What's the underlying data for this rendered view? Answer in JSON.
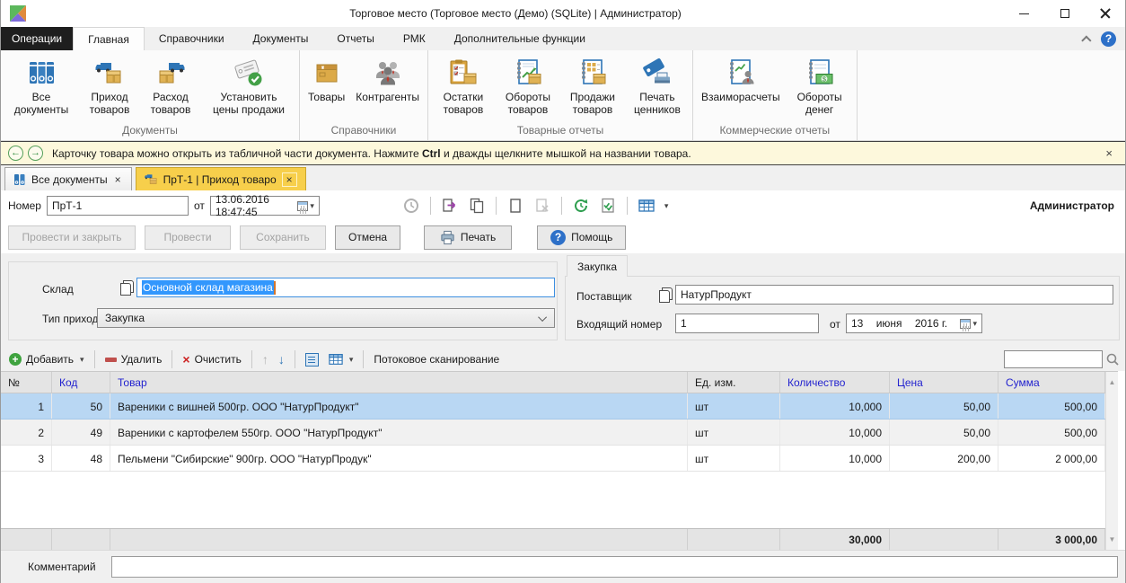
{
  "window": {
    "title": "Торговое место (Торговое место (Демо) (SQLite) | Администратор)"
  },
  "glyphs": {
    "back": "←",
    "forward": "→",
    "close": "×",
    "dropdown": "▾",
    "up": "↑",
    "down": "↓",
    "scroll_up": "▲",
    "scroll_down": "▼",
    "help": "?",
    "plus": "+",
    "clear_x": "×"
  },
  "menubar": {
    "app_button": "Операции",
    "tabs": [
      "Главная",
      "Справочники",
      "Документы",
      "Отчеты",
      "РМК",
      "Дополнительные функции"
    ],
    "active_tab": "Главная"
  },
  "ribbon": {
    "groups": [
      {
        "title": "Документы",
        "buttons": [
          {
            "label": "Все документы",
            "icon": "binders-icon"
          },
          {
            "label": "Приход товаров",
            "icon": "goods-receipt-icon"
          },
          {
            "label": "Расход товаров",
            "icon": "goods-issue-icon"
          },
          {
            "label": "Установить цены продажи",
            "icon": "price-tag-check-icon"
          }
        ]
      },
      {
        "title": "Справочники",
        "buttons": [
          {
            "label": "Товары",
            "icon": "goods-box-icon"
          },
          {
            "label": "Контрагенты",
            "icon": "counterparties-icon"
          }
        ]
      },
      {
        "title": "Товарные отчеты",
        "buttons": [
          {
            "label": "Остатки товаров",
            "icon": "stock-report-icon"
          },
          {
            "label": "Обороты товаров",
            "icon": "goods-turnover-icon"
          },
          {
            "label": "Продажи товаров",
            "icon": "goods-sales-icon"
          },
          {
            "label": "Печать ценников",
            "icon": "print-price-tags-icon"
          }
        ]
      },
      {
        "title": "Коммерческие отчеты",
        "buttons": [
          {
            "label": "Взаиморасчеты",
            "icon": "settlements-icon"
          },
          {
            "label": "Обороты денег",
            "icon": "money-turnover-icon"
          }
        ]
      }
    ]
  },
  "notification": {
    "text_before": "Карточку товара можно открыть из табличной части документа. Нажмите ",
    "bold": "Ctrl",
    "text_after": " и дважды щелкните мышкой на названии товара."
  },
  "doc_tabs": [
    {
      "label": "Все документы",
      "active": false
    },
    {
      "label": "ПрТ-1 | Приход товаро",
      "active": true
    }
  ],
  "doc_header": {
    "number_label": "Номер",
    "number": "ПрТ-1",
    "from_label": "от",
    "datetime": "13.06.2016 18:47:45",
    "user": "Администратор"
  },
  "actions": {
    "post_and_close": "Провести и закрыть",
    "post": "Провести",
    "save": "Сохранить",
    "cancel": "Отмена",
    "print": "Печать",
    "help": "Помощь"
  },
  "form": {
    "warehouse_label": "Склад",
    "warehouse": "Основной склад магазина",
    "income_type_label": "Тип прихода",
    "income_type": "Закупка"
  },
  "purchase": {
    "tab": "Закупка",
    "supplier_label": "Поставщик",
    "supplier": "НатурПродукт",
    "incoming_number_label": "Входящий номер",
    "incoming_number": "1",
    "from_label": "от",
    "date_day": "13",
    "date_month": "июня",
    "date_year": "2016 г."
  },
  "table_toolbar": {
    "add": "Добавить",
    "delete": "Удалить",
    "clear": "Очистить",
    "stream_scan": "Потоковое сканирование",
    "search_value": ""
  },
  "table": {
    "columns": [
      "№",
      "Код",
      "Товар",
      "Ед. изм.",
      "Количество",
      "Цена",
      "Сумма"
    ],
    "rows": [
      [
        "1",
        "50",
        "Вареники с вишней 500гр. ООО \"НатурПродукт\"",
        "шт",
        "10,000",
        "50,00",
        "500,00"
      ],
      [
        "2",
        "49",
        "Вареники с картофелем 550гр. ООО \"НатурПродукт\"",
        "шт",
        "10,000",
        "50,00",
        "500,00"
      ],
      [
        "3",
        "48",
        "Пельмени \"Сибирские\" 900гр. ООО \"НатурПродук\"",
        "шт",
        "10,000",
        "200,00",
        "2 000,00"
      ]
    ],
    "totals": {
      "qty": "30,000",
      "sum": "3 000,00"
    }
  },
  "comment": {
    "label": "Комментарий",
    "value": ""
  },
  "colors": {
    "active_doc_tab": "#f7cf4b",
    "selection_row": "#b9d7f3",
    "header_link_blue": "#2323cf",
    "notification_bg": "#fdf8dc",
    "accent_blue": "#2e75b6",
    "accent_gold": "#dcaa48"
  }
}
